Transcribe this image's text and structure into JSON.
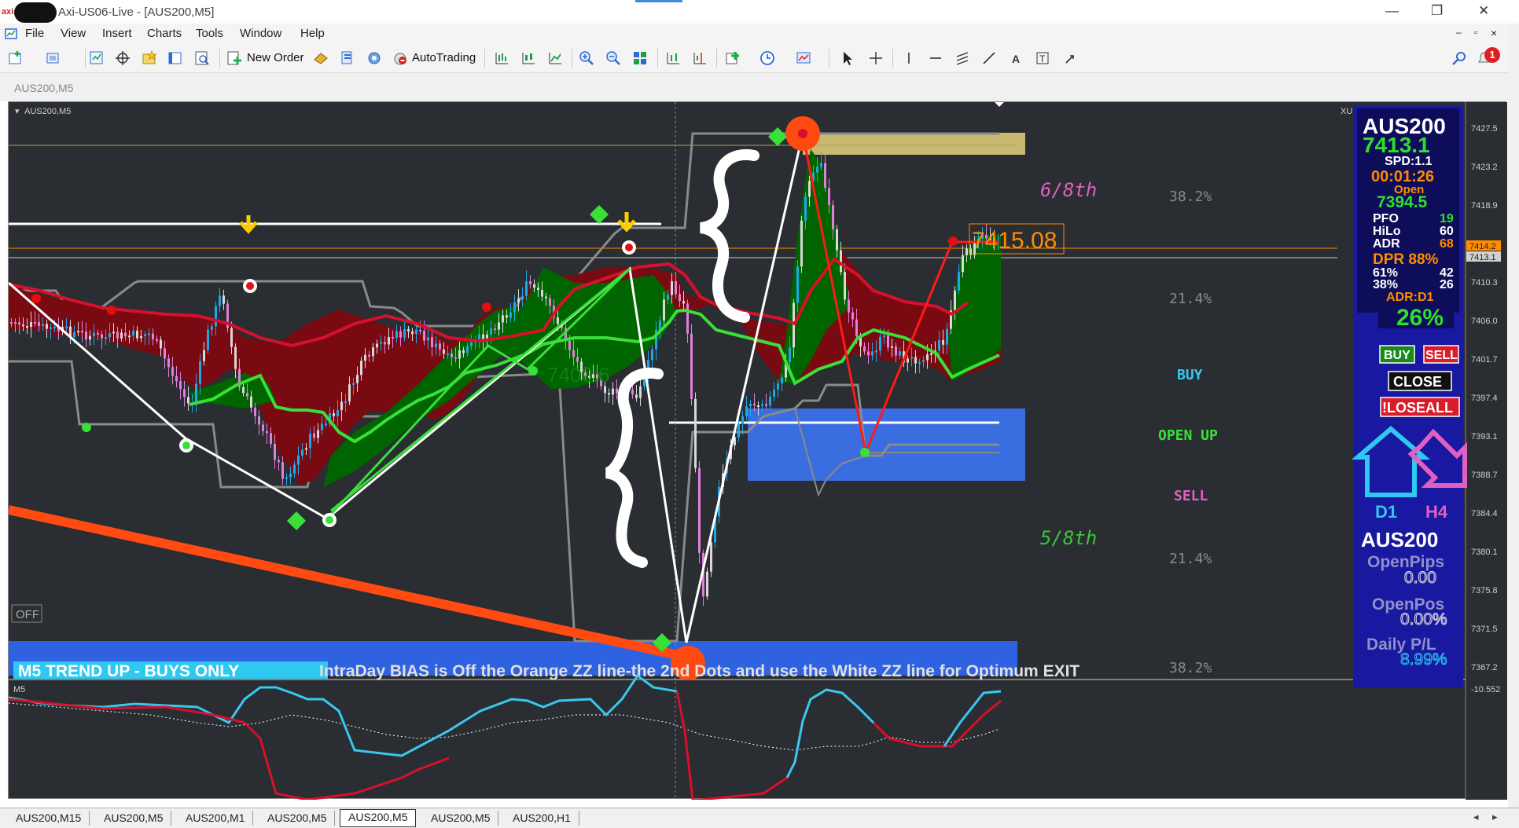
{
  "window": {
    "logo_text": "axi",
    "title": "Axi-US06-Live - [AUS200,M5]",
    "minimize": "—",
    "restore": "❐",
    "close": "✕"
  },
  "menu": {
    "items": [
      "File",
      "View",
      "Insert",
      "Charts",
      "Tools",
      "Window",
      "Help"
    ],
    "mdi_minimize": "–",
    "mdi_restore": "▫",
    "mdi_close": "×"
  },
  "toolbar": {
    "new_order_label": "New Order",
    "autotrading_label": "AutoTrading",
    "notification_count": "1"
  },
  "chart_window_title": "AUS200,M5",
  "chart": {
    "inner_symbol": "AUS200,M5",
    "corner_label": "XU",
    "off_button": "OFF",
    "price_axis": [
      "7427.5",
      "7423.2",
      "7418.9",
      "7414.6",
      "7410.3",
      "7406.0",
      "7401.7",
      "7397.4",
      "7393.1",
      "7388.7",
      "7384.4",
      "7380.1",
      "7375.8",
      "7371.5",
      "7367.2"
    ],
    "price_tag_ask": "7414.2",
    "price_tag_bid": "7413.1",
    "big_price_label": "7415.08",
    "mid_price_label": "7400.6",
    "octave_upper": "6/8th",
    "octave_lower": "5/8th",
    "fib_labels": [
      "38.2%",
      "21.4%",
      "21.4%",
      "38.2%"
    ],
    "signal_buy": "BUY",
    "signal_open_up": "OPEN UP",
    "signal_sell": "SELL",
    "trend_banner": "M5 TREND UP - BUYS ONLY",
    "bias_text": "IntraDay BIAS is Off the Orange ZZ line-the 2nd Dots and use the White ZZ line for Optimum EXIT",
    "colors": {
      "background": "#2a2d31",
      "banner_blue": "#2e62e0",
      "orange_zz": "#ff4a12",
      "bull_cloud": "#006400",
      "bear_cloud": "#7a0a12",
      "supply_zone": "#c8b870",
      "demand_zone": "#3a6ee0"
    }
  },
  "panel": {
    "symbol": "AUS200",
    "price": "7413.1",
    "spread": "SPD:1.1",
    "timer": "00:01:26",
    "open_label": "Open",
    "open_price": "7394.5",
    "rows": [
      {
        "label": "PFO",
        "value": "19",
        "color": "#2ee02e"
      },
      {
        "label": "HiLo",
        "value": "60",
        "color": "#ffffff"
      },
      {
        "label": "ADR",
        "value": "68",
        "color": "#ff8c00"
      }
    ],
    "dpr": "DPR 88%",
    "pct_rows": [
      {
        "label": "61%",
        "value": "42"
      },
      {
        "label": "38%",
        "value": "26"
      }
    ],
    "adr_d1": "ADR:D1",
    "adr_pct": "26%",
    "buy_button": "BUY",
    "sell_button": "SELL",
    "close_button": "CLOSE",
    "loseall_button": "!LOSEALL",
    "tf_left": "D1",
    "tf_right": "H4",
    "symbol2": "AUS200",
    "openpips_label": "OpenPips",
    "openpips_value": "0.00",
    "openpos_label": "OpenPos",
    "openpos_value": "0.00%",
    "dailypl_label": "Daily P/L",
    "dailypl_value": "8.99%"
  },
  "sub_window": {
    "label": "M5",
    "axis_value": "-10.552"
  },
  "tabs": {
    "items": [
      "AUS200,M15",
      "AUS200,M5",
      "AUS200,M1",
      "AUS200,M5",
      "AUS200,M5",
      "AUS200,M5",
      "AUS200,H1"
    ],
    "active_index": 4,
    "prev_arrow": "◂",
    "next_arrow": "▸"
  }
}
